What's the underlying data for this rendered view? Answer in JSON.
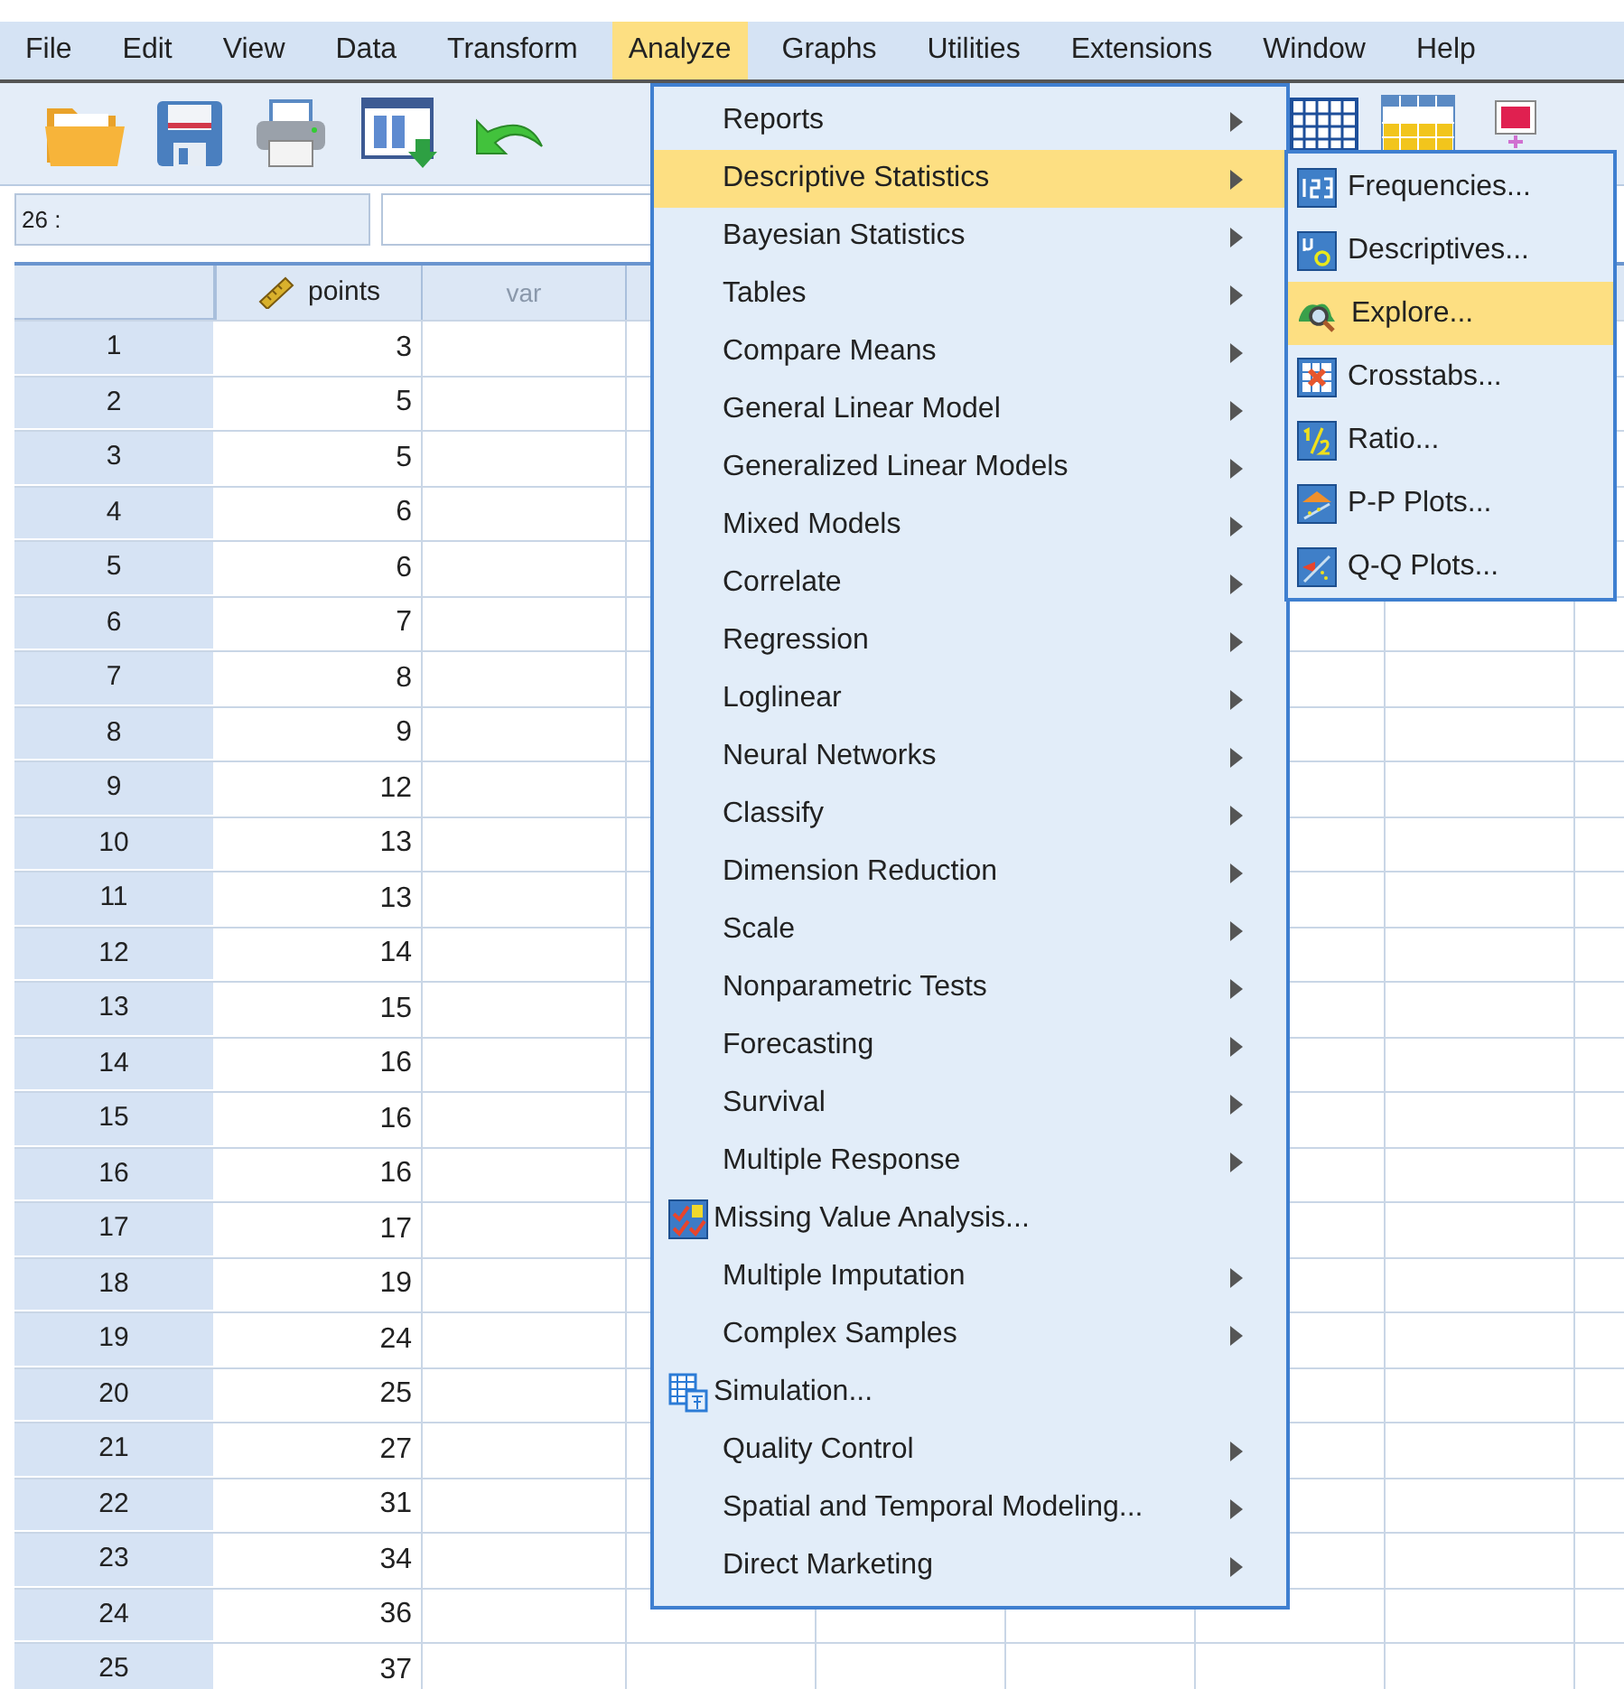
{
  "menubar": [
    {
      "label": "File",
      "selected": false
    },
    {
      "label": "Edit",
      "selected": false
    },
    {
      "label": "View",
      "selected": false
    },
    {
      "label": "Data",
      "selected": false
    },
    {
      "label": "Transform",
      "selected": false
    },
    {
      "label": "Analyze",
      "selected": true
    },
    {
      "label": "Graphs",
      "selected": false
    },
    {
      "label": "Utilities",
      "selected": false
    },
    {
      "label": "Extensions",
      "selected": false
    },
    {
      "label": "Window",
      "selected": false
    },
    {
      "label": "Help",
      "selected": false
    }
  ],
  "cell_editor": {
    "cell_ref": "26 :"
  },
  "grid": {
    "columns": [
      {
        "label": "points",
        "kind": "scale"
      },
      {
        "label": "var",
        "kind": "empty"
      }
    ],
    "rows": [
      {
        "row": "1",
        "points": "3"
      },
      {
        "row": "2",
        "points": "5"
      },
      {
        "row": "3",
        "points": "5"
      },
      {
        "row": "4",
        "points": "6"
      },
      {
        "row": "5",
        "points": "6"
      },
      {
        "row": "6",
        "points": "7"
      },
      {
        "row": "7",
        "points": "8"
      },
      {
        "row": "8",
        "points": "9"
      },
      {
        "row": "9",
        "points": "12"
      },
      {
        "row": "10",
        "points": "13"
      },
      {
        "row": "11",
        "points": "13"
      },
      {
        "row": "12",
        "points": "14"
      },
      {
        "row": "13",
        "points": "15"
      },
      {
        "row": "14",
        "points": "16"
      },
      {
        "row": "15",
        "points": "16"
      },
      {
        "row": "16",
        "points": "16"
      },
      {
        "row": "17",
        "points": "17"
      },
      {
        "row": "18",
        "points": "19"
      },
      {
        "row": "19",
        "points": "24"
      },
      {
        "row": "20",
        "points": "25"
      },
      {
        "row": "21",
        "points": "27"
      },
      {
        "row": "22",
        "points": "31"
      },
      {
        "row": "23",
        "points": "34"
      },
      {
        "row": "24",
        "points": "36"
      },
      {
        "row": "25",
        "points": "37"
      }
    ]
  },
  "analyze_menu": [
    {
      "label": "Reports",
      "kind": "submenu",
      "selected": false
    },
    {
      "label": "Descriptive Statistics",
      "kind": "submenu",
      "selected": true
    },
    {
      "label": "Bayesian Statistics",
      "kind": "submenu",
      "selected": false
    },
    {
      "label": "Tables",
      "kind": "submenu",
      "selected": false
    },
    {
      "label": "Compare Means",
      "kind": "submenu",
      "selected": false
    },
    {
      "label": "General Linear Model",
      "kind": "submenu",
      "selected": false
    },
    {
      "label": "Generalized Linear Models",
      "kind": "submenu",
      "selected": false
    },
    {
      "label": "Mixed Models",
      "kind": "submenu",
      "selected": false
    },
    {
      "label": "Correlate",
      "kind": "submenu",
      "selected": false
    },
    {
      "label": "Regression",
      "kind": "submenu",
      "selected": false
    },
    {
      "label": "Loglinear",
      "kind": "submenu",
      "selected": false
    },
    {
      "label": "Neural Networks",
      "kind": "submenu",
      "selected": false
    },
    {
      "label": "Classify",
      "kind": "submenu",
      "selected": false
    },
    {
      "label": "Dimension Reduction",
      "kind": "submenu",
      "selected": false
    },
    {
      "label": "Scale",
      "kind": "submenu",
      "selected": false
    },
    {
      "label": "Nonparametric Tests",
      "kind": "submenu",
      "selected": false
    },
    {
      "label": "Forecasting",
      "kind": "submenu",
      "selected": false
    },
    {
      "label": "Survival",
      "kind": "submenu",
      "selected": false
    },
    {
      "label": "Multiple Response",
      "kind": "submenu",
      "selected": false
    },
    {
      "label": "Missing Value Analysis...",
      "kind": "missing-values",
      "selected": false
    },
    {
      "label": "Multiple Imputation",
      "kind": "submenu",
      "selected": false
    },
    {
      "label": "Complex Samples",
      "kind": "submenu",
      "selected": false
    },
    {
      "label": "Simulation...",
      "kind": "simulation",
      "selected": false
    },
    {
      "label": "Quality Control",
      "kind": "submenu",
      "selected": false
    },
    {
      "label": "Spatial and Temporal Modeling...",
      "kind": "submenu",
      "selected": false
    },
    {
      "label": "Direct Marketing",
      "kind": "submenu",
      "selected": false
    }
  ],
  "descriptive_submenu": [
    {
      "label": "Frequencies...",
      "kind": "frequencies",
      "selected": false
    },
    {
      "label": "Descriptives...",
      "kind": "descriptives",
      "selected": false
    },
    {
      "label": "Explore...",
      "kind": "explore",
      "selected": true
    },
    {
      "label": "Crosstabs...",
      "kind": "crosstabs",
      "selected": false
    },
    {
      "label": "Ratio...",
      "kind": "ratio",
      "selected": false
    },
    {
      "label": "P-P Plots...",
      "kind": "pp",
      "selected": false
    },
    {
      "label": "Q-Q Plots...",
      "kind": "qq",
      "selected": false
    }
  ]
}
